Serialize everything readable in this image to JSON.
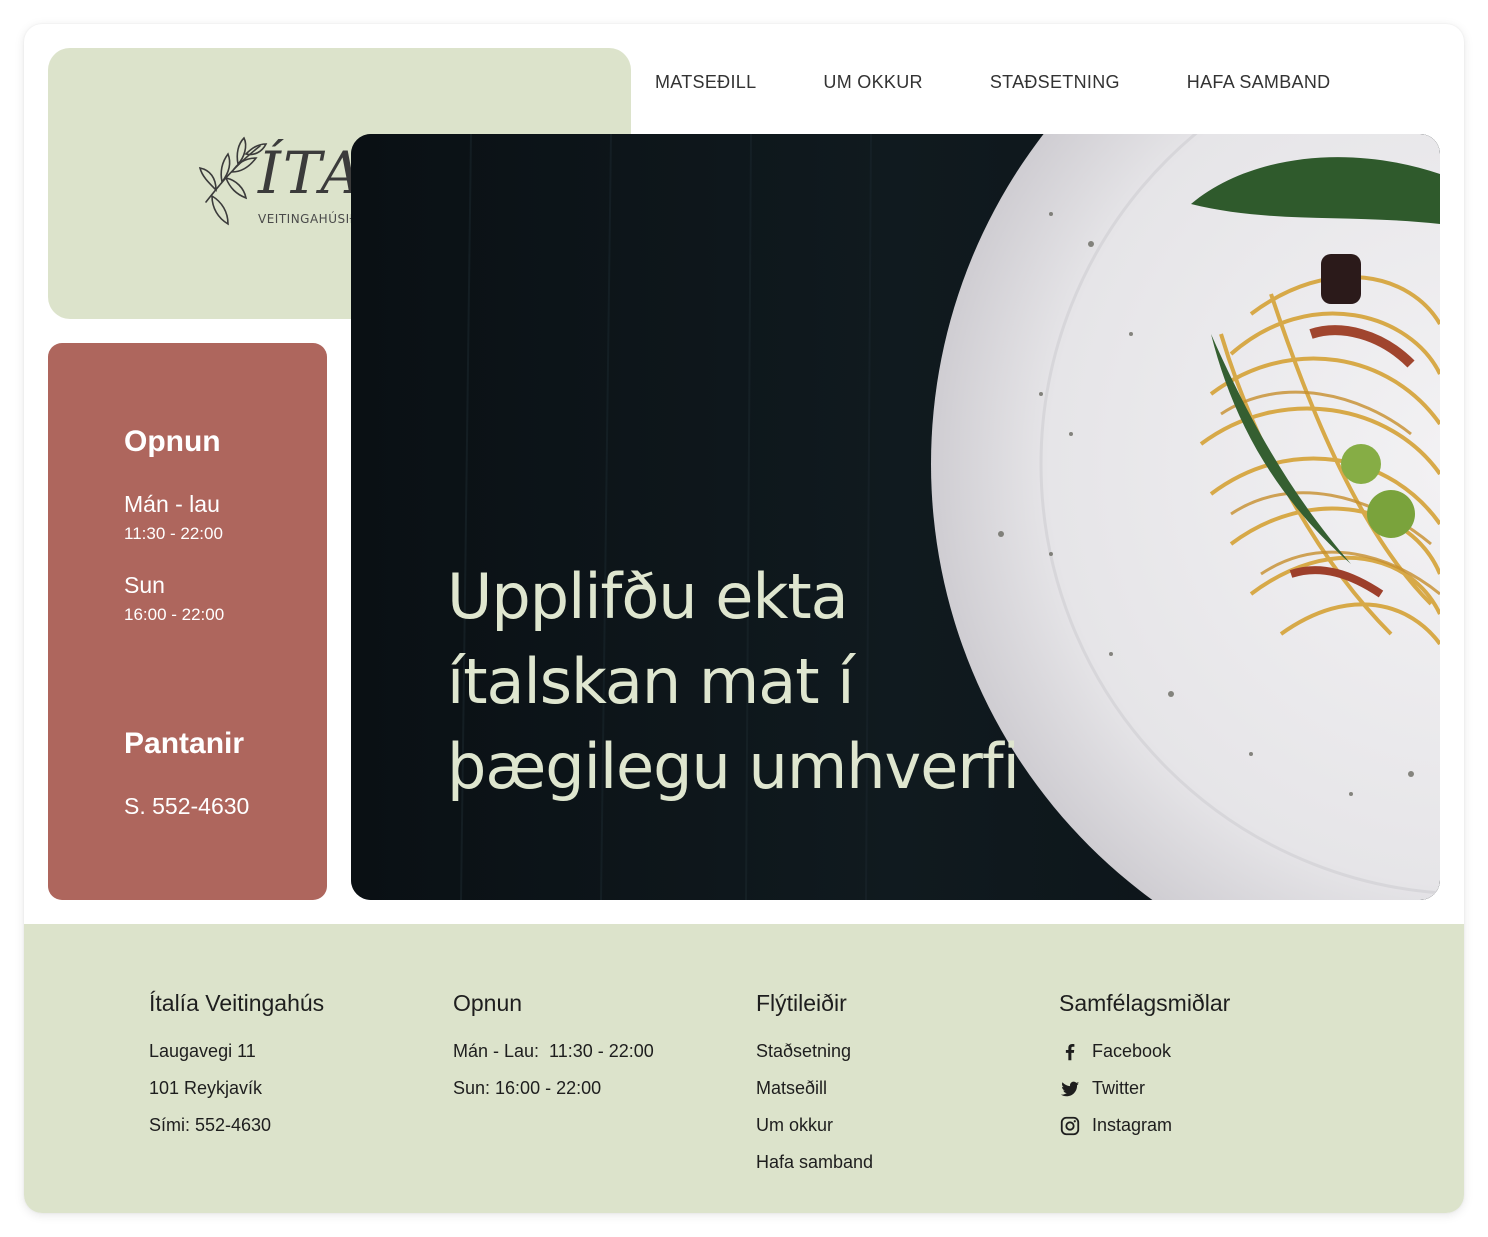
{
  "logo": {
    "word": "ÍTALÍA",
    "subtitle": "VEITINGAHÚSIÐ"
  },
  "nav": {
    "items": [
      {
        "label": "MATSEÐILL"
      },
      {
        "label": "UM OKKUR"
      },
      {
        "label": "STAÐSETNING"
      },
      {
        "label": "HAFA SAMBAND"
      }
    ]
  },
  "hours_card": {
    "title": "Opnun",
    "rows": [
      {
        "day": "Mán - lau",
        "time": "11:30 - 22:00"
      },
      {
        "day": "Sun",
        "time": "16:00 - 22:00"
      }
    ],
    "reservations_title": "Pantanir",
    "phone": "S. 552-4630"
  },
  "hero": {
    "headline_lines": [
      "Upplifðu ekta",
      "ítalskan mat í",
      "þægilegu umhverfi"
    ]
  },
  "footer": {
    "columns": [
      {
        "title": "Ítalía Veitingahús",
        "items": [
          "Laugavegi 11",
          "101 Reykjavík",
          "Sími: 552-4630"
        ]
      },
      {
        "title": "Opnun",
        "items": [
          "Mán - Lau:  11:30 - 22:00",
          "Sun: 16:00 - 22:00"
        ]
      },
      {
        "title": "Flýtileiðir",
        "items": [
          "Staðsetning",
          "Matseðill",
          "Um okkur",
          "Hafa samband"
        ]
      },
      {
        "title": "Samfélagsmiðlar",
        "items": [
          {
            "label": "Facebook",
            "icon": "facebook-icon"
          },
          {
            "label": "Twitter",
            "icon": "twitter-icon"
          },
          {
            "label": "Instagram",
            "icon": "instagram-icon"
          }
        ]
      }
    ]
  },
  "colors": {
    "sage": "#dce3cb",
    "terracotta": "#ae665d",
    "hero_text": "#dfe6cf",
    "dark_text": "#1e1e1e"
  }
}
